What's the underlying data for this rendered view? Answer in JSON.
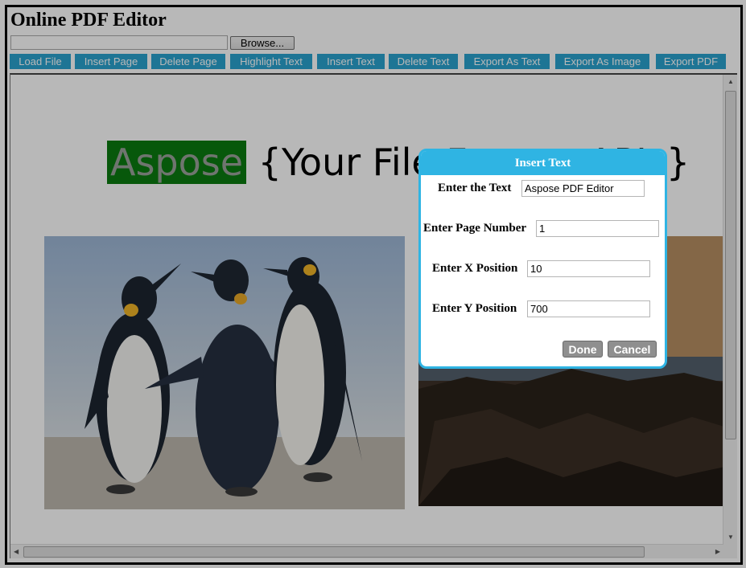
{
  "app": {
    "title": "Online PDF Editor"
  },
  "file_picker": {
    "browse_label": "Browse..."
  },
  "toolbar": {
    "buttons": [
      "Load File",
      "Insert Page",
      "Delete Page",
      "Highlight Text",
      "Insert Text",
      "Delete Text",
      "Export As Text",
      "Export As Image",
      "Export PDF"
    ]
  },
  "document": {
    "headline_highlight": "Aspose",
    "headline_rest": "{Your File Format APIs}"
  },
  "dialog": {
    "title": "Insert Text",
    "text_label": "Enter the Text",
    "text_value": "Aspose PDF Editor",
    "page_label": "Enter Page Number",
    "page_value": "1",
    "x_label": "Enter X Position",
    "x_value": "10",
    "y_label": "Enter Y Position",
    "y_value": "700",
    "done_label": "Done",
    "cancel_label": "Cancel"
  },
  "colors": {
    "toolbar_button": "#2aa3cf",
    "dialog_accent": "#2fb4e3",
    "highlight": "#0a7a10"
  }
}
